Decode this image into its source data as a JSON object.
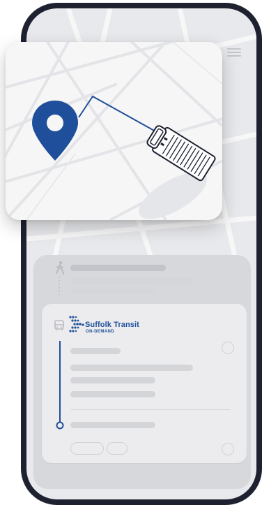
{
  "brand": {
    "name": "Suffolk Transit",
    "subtitle": "ON-DEMAND"
  },
  "colors": {
    "phone_frame": "#1e2130",
    "screen_bg": "#e8e9ec",
    "brand_blue": "#1f4f9a",
    "route_line": "#1f4f9a",
    "map_card_bg": "#f6f6f7",
    "placeholder": "#c2c4c9"
  },
  "icons": {
    "menu": "hamburger-menu-icon",
    "walk": "walking-person-icon",
    "bus": "bus-icon",
    "pin": "location-pin-icon",
    "vehicle": "shuttle-van-icon",
    "logo": "suffolk-transit-chevron-logo"
  }
}
